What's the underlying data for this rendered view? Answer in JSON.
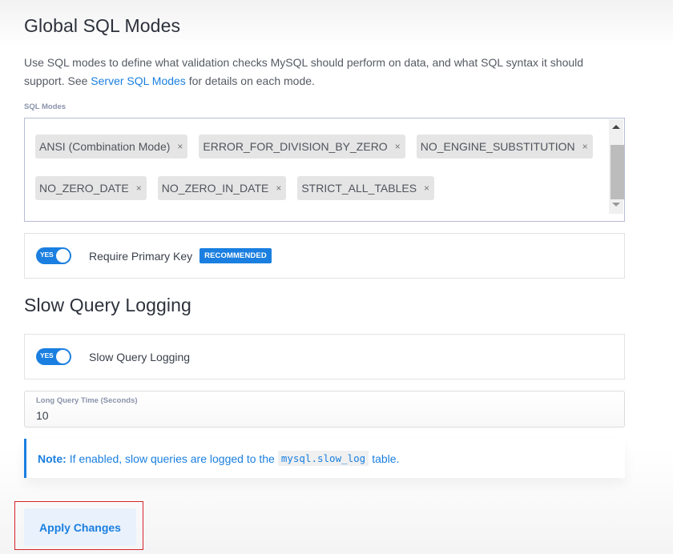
{
  "sql_modes_section": {
    "title": "Global SQL Modes",
    "description_before_link": "Use SQL modes to define what validation checks MySQL should perform on data, and what SQL syntax it should support. See ",
    "link_text": "Server SQL Modes",
    "description_after_link": " for details on each mode.",
    "field_label": "SQL Modes",
    "selected_modes": [
      "ANSI (Combination Mode)",
      "ERROR_FOR_DIVISION_BY_ZERO",
      "NO_ENGINE_SUBSTITUTION",
      "NO_ZERO_DATE",
      "NO_ZERO_IN_DATE",
      "STRICT_ALL_TABLES"
    ],
    "remove_glyph": "×",
    "require_primary_key": {
      "toggle_state": "YES",
      "enabled": true,
      "label": "Require Primary Key",
      "badge": "RECOMMENDED"
    }
  },
  "slow_query_section": {
    "title": "Slow Query Logging",
    "slow_query_logging": {
      "toggle_state": "YES",
      "enabled": true,
      "label": "Slow Query Logging"
    },
    "long_query_time": {
      "label": "Long Query Time (Seconds)",
      "value": "10"
    },
    "note": {
      "prefix": "Note:",
      "text_before_code": "If enabled, slow queries are logged to the",
      "code": "mysql.slow_log",
      "text_after_code": "table."
    }
  },
  "actions": {
    "apply_label": "Apply Changes"
  },
  "colors": {
    "accent": "#1a7fe0",
    "focus_ring": "#d6242c",
    "chip_bg": "#e5e5e5",
    "button_bg": "#e9f1fc"
  }
}
